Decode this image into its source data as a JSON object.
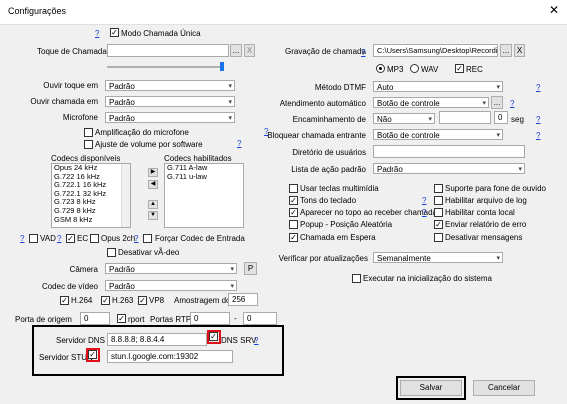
{
  "window": {
    "title": "Configurações",
    "close": "✕"
  },
  "left": {
    "modo_chamada_unica": "Modo Chamada Única",
    "toque_label": "Toque de Chamada",
    "toque_value": "",
    "ouvir_toque_label": "Ouvir toque em",
    "ouvir_toque_value": "Padrão",
    "ouvir_chamada_label": "Ouvir chamada em",
    "ouvir_chamada_value": "Padrão",
    "microfone_label": "Microfone",
    "microfone_value": "Padrão",
    "amplificacao": "Amplificação do microfone",
    "ajuste_volume": "Ajuste de volume por software",
    "codecs_disp_label": "Codecs disponíveis",
    "codecs_disp": [
      "Opus 24 kHz",
      "G.722 16 kHz",
      "G.722.1 16 kHz",
      "G.722.1 32 kHz",
      "G.723 8 kHz",
      "G.729 8 kHz",
      "GSM 8 kHz"
    ],
    "codecs_hab_label": "Codecs habilitados",
    "codecs_hab": [
      "G.711 A-law",
      "G.711 u-law"
    ],
    "vad": "VAD",
    "ec": "EC",
    "opus2ch": "Opus 2ch",
    "forcar_codec": "Forçar Codec de Entrada",
    "desativar_video": "Desativar vÃ-deo",
    "camera_label": "Câmera",
    "camera_value": "Padrão",
    "camera_p": "P",
    "codec_video_label": "Codec de vídeo",
    "codec_video_value": "Padrão",
    "h264": "H.264",
    "h263": "H.263",
    "vp8": "VP8",
    "amostragem_label": "Amostragem do",
    "amostragem_value": "256",
    "porta_origem_label": "Porta de origem",
    "porta_origem_value": "0",
    "rport": "rport",
    "portas_rtp_label": "Portas RTP",
    "portas_rtp_from": "0",
    "portas_rtp_sep": "-",
    "portas_rtp_to": "0",
    "servidor_dns_label": "Servidor DNS",
    "servidor_dns_value": "8.8.8.8; 8.8.4.4",
    "dns_srv": "DNS SRV",
    "servidor_stun_label": "Servidor STUN",
    "servidor_stun_value": "stun.l.google.com:19302"
  },
  "right": {
    "gravacao_label": "Gravação de chamada",
    "gravacao_value": "C:\\Users\\Samsung\\Desktop\\Recordin",
    "mp3": "MP3",
    "wav": "WAV",
    "rec": "REC",
    "metodo_dtmf_label": "Método DTMF",
    "metodo_dtmf_value": "Auto",
    "atendimento_label": "Atendimento automático",
    "atendimento_value": "Botão de controle",
    "encaminhamento_label": "Encaminhamento de",
    "encaminhamento_value": "Não",
    "encaminhamento_seg": "0",
    "seg": "seg",
    "bloquear_label": "Bloquear chamada entrante",
    "bloquear_value": "Botão de controle",
    "diretorio_label": "Diretório de usuários",
    "diretorio_value": "",
    "lista_acao_label": "Lista de ação padrão",
    "lista_acao_value": "Padrão",
    "usar_teclas": "Usar teclas multimídia",
    "tons_teclado": "Tons do teclado",
    "aparecer_topo": "Aparecer no topo ao receber chamada",
    "popup": "Popup - Posição Aleatória",
    "chamada_espera": "Chamada em Espera",
    "suporte_fone": "Suporte para fone de ouvido",
    "habilitar_arquivo": "Habilitar arquivo de log",
    "habilitar_conta": "Habilitar conta local",
    "enviar_relatorio": "Enviar relatório de erro",
    "desativar_msgs": "Desativar mensagens",
    "verificar_label": "Verificar por atualizações",
    "verificar_value": "Semanalmente",
    "executar": "Executar na inicialização do sistema"
  },
  "footer": {
    "salvar": "Salvar",
    "cancelar": "Cancelar"
  },
  "help": "?",
  "dots": "...",
  "x": "X",
  "arrow_down": "▾",
  "accent_red": "#e0101a",
  "link_blue": "#1a3fd8"
}
